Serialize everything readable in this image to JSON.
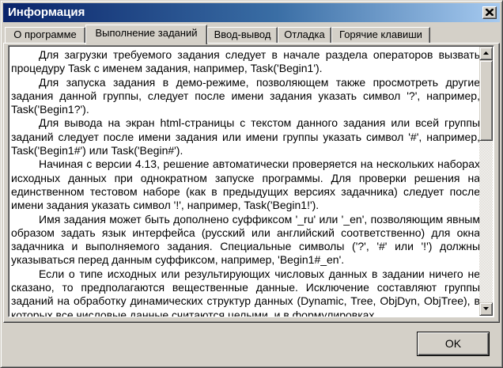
{
  "window": {
    "title": "Информация"
  },
  "tabs": [
    {
      "label": "О программе",
      "active": false
    },
    {
      "label": "Выполнение заданий",
      "active": true
    },
    {
      "label": "Ввод-вывод",
      "active": false
    },
    {
      "label": "Отладка",
      "active": false
    },
    {
      "label": "Горячие клавиши",
      "active": false
    }
  ],
  "content": {
    "paragraphs": [
      "Для загрузки требуемого задания следует в начале раздела операторов вызвать процедуру Task с именем задания, например, Task('Begin1').",
      "Для запуска задания в демо-режиме, позволяющем также просмотреть другие задания данной группы, следует после имени задания указать символ '?', например, Task('Begin1?').",
      "Для вывода на экран html-страницы с текстом данного задания или всей группы заданий следует после имени задания или имени группы указать символ '#', например, Task('Begin1#') или Task('Begin#').",
      "Начиная с версии 4.13, решение автоматически проверяется на нескольких наборах исходных данных при однократном запуске программы. Для проверки решения на единственном тестовом наборе (как в предыдущих версиях задачника) следует после имени задания указать символ '!', например, Task('Begin1!').",
      "Имя задания может быть дополнено суффиксом '_ru' или '_en', позволяющим явным образом задать язык интерфейса (русский или английский соответственно) для окна задачника и выполняемого задания. Специальные символы ('?', '#' или '!') должны указываться перед данным суффиксом, например, 'Begin1#_en'.",
      "Если о типе исходных или результирующих числовых данных в задании ничего не сказано, то предполагаются вещественные данные. Исключение составляют группы заданий на обработку динамических структур данных (Dynamic, Tree, ObjDyn, ObjTree), в которых все числовые данные считаются целыми, и в формулировках"
    ],
    "scroll_position": 0.0
  },
  "buttons": {
    "ok_label": "OK"
  },
  "icons": {
    "close": "close-icon",
    "scroll_up": "arrow-up-icon",
    "scroll_down": "arrow-down-icon"
  },
  "colors": {
    "titlebar_start": "#0a246a",
    "titlebar_end": "#a6caf0",
    "face": "#d4d0c8"
  }
}
